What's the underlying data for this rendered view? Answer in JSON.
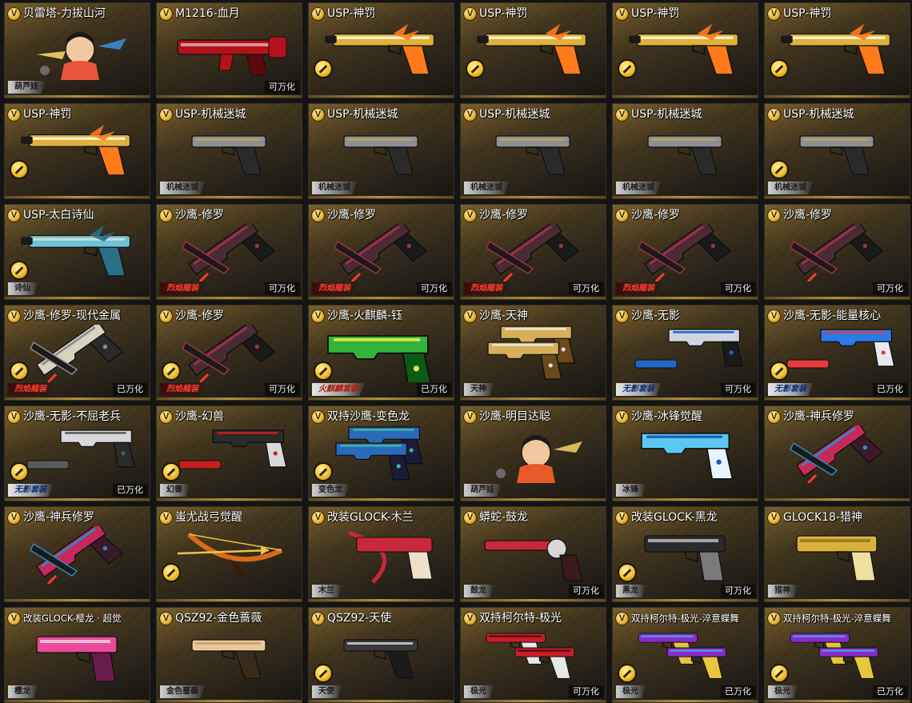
{
  "colors": {
    "card_gold": "#b48c3c",
    "background": "#141414",
    "badge_gold": "#e6b638",
    "tag_red": "#ff3b2f"
  },
  "badge_letter": "V",
  "cards": [
    {
      "name": "贝雷塔-力拔山河",
      "tag": "葫芦娃",
      "tag_style": "plain",
      "coin": false,
      "wanhua": "",
      "art": "character",
      "palette": [
        "#e8553b",
        "#3b8fd9",
        "#f6d26b"
      ]
    },
    {
      "name": "M1216-血月",
      "tag": "",
      "tag_style": "plain",
      "coin": false,
      "wanhua": "可万化",
      "art": "rifle",
      "palette": [
        "#b3121a",
        "#e9e9e9",
        "#5a0a0a"
      ]
    },
    {
      "name": "USP-神罚",
      "tag": "",
      "tag_style": "plain",
      "coin": true,
      "wanhua": "",
      "art": "pistol-long",
      "palette": [
        "#e0b23a",
        "#ffffff",
        "#ff7a1a"
      ]
    },
    {
      "name": "USP-神罚",
      "tag": "",
      "tag_style": "plain",
      "coin": true,
      "wanhua": "",
      "art": "pistol-long",
      "palette": [
        "#e0b23a",
        "#ffffff",
        "#ff7a1a"
      ]
    },
    {
      "name": "USP-神罚",
      "tag": "",
      "tag_style": "plain",
      "coin": true,
      "wanhua": "",
      "art": "pistol-long",
      "palette": [
        "#e0b23a",
        "#ffffff",
        "#ff7a1a"
      ]
    },
    {
      "name": "USP-神罚",
      "tag": "",
      "tag_style": "plain",
      "coin": true,
      "wanhua": "",
      "art": "pistol-long",
      "palette": [
        "#e0b23a",
        "#ffffff",
        "#ff7a1a"
      ]
    },
    {
      "name": "USP-神罚",
      "tag": "",
      "tag_style": "plain",
      "coin": true,
      "wanhua": "",
      "art": "pistol-long",
      "palette": [
        "#e0b23a",
        "#ffffff",
        "#ff7a1a"
      ]
    },
    {
      "name": "USP-机械迷城",
      "tag": "机械迷城",
      "tag_style": "plain",
      "coin": false,
      "wanhua": "",
      "art": "pistol",
      "palette": [
        "#8c9096",
        "#c8a24a",
        "#2a2a2a"
      ]
    },
    {
      "name": "USP-机械迷城",
      "tag": "机械迷城",
      "tag_style": "plain",
      "coin": false,
      "wanhua": "",
      "art": "pistol",
      "palette": [
        "#8c9096",
        "#c8a24a",
        "#2a2a2a"
      ]
    },
    {
      "name": "USP-机械迷城",
      "tag": "机械迷城",
      "tag_style": "plain",
      "coin": false,
      "wanhua": "",
      "art": "pistol",
      "palette": [
        "#8c9096",
        "#c8a24a",
        "#2a2a2a"
      ]
    },
    {
      "name": "USP-机械迷城",
      "tag": "机械迷城",
      "tag_style": "plain",
      "coin": false,
      "wanhua": "",
      "art": "pistol",
      "palette": [
        "#8c9096",
        "#c8a24a",
        "#2a2a2a"
      ]
    },
    {
      "name": "USP-机械迷城",
      "tag": "机械迷城",
      "tag_style": "plain",
      "coin": true,
      "wanhua": "",
      "art": "pistol",
      "palette": [
        "#8c9096",
        "#c8a24a",
        "#2a2a2a"
      ]
    },
    {
      "name": "USP-太白诗仙",
      "tag": "诗仙",
      "tag_style": "plain",
      "coin": true,
      "wanhua": "",
      "art": "pistol-long",
      "palette": [
        "#6ec3d6",
        "#e8e0c8",
        "#2a6f86"
      ]
    },
    {
      "name": "沙鹰-修罗",
      "tag": "烈焰龍装",
      "tag_style": "red",
      "coin": false,
      "wanhua": "可万化",
      "art": "eagle-cross",
      "palette": [
        "#4a2a34",
        "#a0304a",
        "#1a1a1a"
      ]
    },
    {
      "name": "沙鹰-修罗",
      "tag": "烈焰龍装",
      "tag_style": "red",
      "coin": false,
      "wanhua": "可万化",
      "art": "eagle-cross",
      "palette": [
        "#4a2a34",
        "#a0304a",
        "#1a1a1a"
      ]
    },
    {
      "name": "沙鹰-修罗",
      "tag": "烈焰龍装",
      "tag_style": "red",
      "coin": false,
      "wanhua": "可万化",
      "art": "eagle-cross",
      "palette": [
        "#4a2a34",
        "#a0304a",
        "#1a1a1a"
      ]
    },
    {
      "name": "沙鹰-修罗",
      "tag": "烈焰龍装",
      "tag_style": "red",
      "coin": false,
      "wanhua": "可万化",
      "art": "eagle-cross",
      "palette": [
        "#4a2a34",
        "#a0304a",
        "#1a1a1a"
      ]
    },
    {
      "name": "沙鹰-修罗",
      "tag": "",
      "tag_style": "plain",
      "coin": false,
      "wanhua": "可万化",
      "art": "eagle-cross",
      "palette": [
        "#4a2a34",
        "#a0304a",
        "#1a1a1a"
      ]
    },
    {
      "name": "沙鹰-修罗-现代金属",
      "tag": "烈焰龍装",
      "tag_style": "red",
      "coin": true,
      "wanhua": "已万化",
      "art": "eagle-cross",
      "palette": [
        "#d8d2c0",
        "#8c8c8c",
        "#2a2a2a"
      ]
    },
    {
      "name": "沙鹰-修罗",
      "tag": "烈焰龍装",
      "tag_style": "red",
      "coin": true,
      "wanhua": "可万化",
      "art": "eagle-cross",
      "palette": [
        "#4a2a34",
        "#a0304a",
        "#1a1a1a"
      ]
    },
    {
      "name": "沙鹰-火麒麟-钰",
      "tag": "火麒麟套装",
      "tag_style": "green",
      "coin": true,
      "wanhua": "已万化",
      "art": "eagle-long",
      "palette": [
        "#34b43c",
        "#d8e84a",
        "#0d5a14"
      ]
    },
    {
      "name": "沙鹰-天神",
      "tag": "天神",
      "tag_style": "plain",
      "coin": false,
      "wanhua": "",
      "art": "eagle-double",
      "palette": [
        "#d8b05a",
        "#e8e8e8",
        "#6a4a1a"
      ]
    },
    {
      "name": "沙鹰-无影",
      "tag": "无影套装",
      "tag_style": "blue",
      "coin": false,
      "wanhua": "可万化",
      "art": "eagle-split",
      "palette": [
        "#d0d6e0",
        "#1f66c8",
        "#1a1a1a"
      ]
    },
    {
      "name": "沙鹰-无影-能量核心",
      "tag": "无影套装",
      "tag_style": "blue",
      "coin": true,
      "wanhua": "已万化",
      "art": "eagle-split",
      "palette": [
        "#2a7ae8",
        "#e83a3a",
        "#e8e8f0"
      ]
    },
    {
      "name": "沙鹰-无影-不屈老兵",
      "tag": "无影套装",
      "tag_style": "blue",
      "coin": true,
      "wanhua": "已万化",
      "art": "eagle-split",
      "palette": [
        "#d8d8d8",
        "#5a5a5a",
        "#2a2a2a"
      ]
    },
    {
      "name": "沙鹰-幻兽",
      "tag": "幻兽",
      "tag_style": "plain",
      "coin": true,
      "wanhua": "",
      "art": "eagle-split",
      "palette": [
        "#2a2a2a",
        "#c81e1e",
        "#d8d8d8"
      ]
    },
    {
      "name": "双持沙鹰-变色龙",
      "tag": "变色龙",
      "tag_style": "plain",
      "coin": true,
      "wanhua": "",
      "art": "eagle-double",
      "palette": [
        "#2a6ab8",
        "#3ab8a0",
        "#1a1a3a"
      ]
    },
    {
      "name": "沙鹰-明目达聪",
      "tag": "葫芦娃",
      "tag_style": "plain",
      "coin": false,
      "wanhua": "",
      "art": "character",
      "palette": [
        "#e85a2a",
        "#f6d26b",
        "#3a2a1a"
      ]
    },
    {
      "name": "沙鹰-冰锋觉醒",
      "tag": "冰锋",
      "tag_style": "plain",
      "coin": false,
      "wanhua": "",
      "art": "eagle",
      "palette": [
        "#5ac8f0",
        "#1a5ab8",
        "#e8f4ff"
      ]
    },
    {
      "name": "沙鹰-神兵修罗",
      "tag": "",
      "tag_style": "plain",
      "coin": false,
      "wanhua": "",
      "art": "eagle-cross",
      "palette": [
        "#c8285a",
        "#2a8ac8",
        "#3a1a2a"
      ]
    },
    {
      "name": "沙鹰-神兵修罗",
      "tag": "",
      "tag_style": "plain",
      "coin": false,
      "wanhua": "",
      "art": "eagle-cross",
      "palette": [
        "#c8285a",
        "#2a8ac8",
        "#3a1a2a"
      ]
    },
    {
      "name": "蚩尤战弓觉醒",
      "tag": "",
      "tag_style": "plain",
      "coin": true,
      "wanhua": "",
      "art": "bow",
      "palette": [
        "#d86a1a",
        "#3a1a0a",
        "#f0c04a"
      ]
    },
    {
      "name": "改装GLOCK-木兰",
      "tag": "木兰",
      "tag_style": "plain",
      "coin": false,
      "wanhua": "",
      "art": "glock-bow",
      "palette": [
        "#c8283a",
        "#f0e0c8",
        "#2a2a2a"
      ]
    },
    {
      "name": "蟒蛇-鼓龙",
      "tag": "鼓龙",
      "tag_style": "plain",
      "coin": false,
      "wanhua": "可万化",
      "art": "revolver",
      "palette": [
        "#c8283a",
        "#d8d8d8",
        "#3a1a1a"
      ]
    },
    {
      "name": "改装GLOCK-黑龙",
      "tag": "黑龙",
      "tag_style": "plain",
      "coin": true,
      "wanhua": "可万化",
      "art": "glock",
      "palette": [
        "#2a2a2a",
        "#d8d8d8",
        "#7a7a7a"
      ]
    },
    {
      "name": "GLOCK18-猎神",
      "tag": "猎神",
      "tag_style": "plain",
      "coin": false,
      "wanhua": "",
      "art": "glock",
      "palette": [
        "#d8b03a",
        "#8a6a1a",
        "#f0e0a0"
      ]
    },
    {
      "name": "改装GLOCK-樱龙 · 超觉",
      "tag": "樱龙",
      "tag_style": "plain",
      "coin": false,
      "wanhua": "",
      "art": "glock",
      "palette": [
        "#e84a9a",
        "#f0f0f0",
        "#6a1a4a"
      ]
    },
    {
      "name": "QSZ92-金色蔷薇",
      "tag": "金色蔷薇",
      "tag_style": "plain",
      "coin": false,
      "wanhua": "",
      "art": "pistol",
      "palette": [
        "#e8c89a",
        "#c89a6a",
        "#3a2a1a"
      ]
    },
    {
      "name": "QSZ92-天使",
      "tag": "天使",
      "tag_style": "plain",
      "coin": true,
      "wanhua": "",
      "art": "pistol",
      "palette": [
        "#3a3a3a",
        "#d8d8d8",
        "#1a1a1a"
      ]
    },
    {
      "name": "双持柯尔特-极光",
      "tag": "极光",
      "tag_style": "plain",
      "coin": false,
      "wanhua": "可万化",
      "art": "pistol-double",
      "palette": [
        "#c81e28",
        "#3a0a0a",
        "#e8e8e8"
      ]
    },
    {
      "name": "双持柯尔特-极光-淬意蝶舞",
      "tag": "极光",
      "tag_style": "plain",
      "coin": true,
      "wanhua": "已万化",
      "art": "pistol-double",
      "palette": [
        "#8a2ac8",
        "#3ab8e8",
        "#e8c83a"
      ]
    },
    {
      "name": "双持柯尔特-极光-淬意蝶舞",
      "tag": "极光",
      "tag_style": "plain",
      "coin": true,
      "wanhua": "已万化",
      "art": "pistol-double",
      "palette": [
        "#8a2ac8",
        "#3ab8e8",
        "#e8c83a"
      ]
    }
  ]
}
